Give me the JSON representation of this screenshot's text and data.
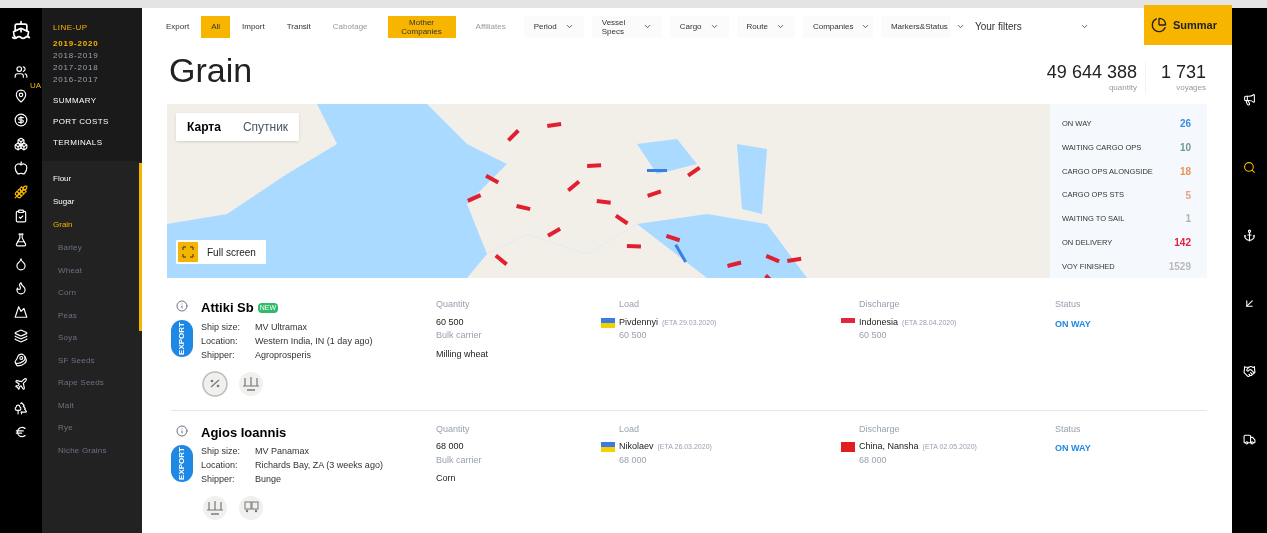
{
  "nav": {
    "section_title": "LINE-UP",
    "seasons": [
      {
        "label": "2019-2020",
        "selected": true
      },
      {
        "label": "2018-2019",
        "selected": false
      },
      {
        "label": "2017-2018",
        "selected": false
      },
      {
        "label": "2016-2017",
        "selected": false
      }
    ],
    "links": [
      "SUMMARY",
      "PORT COSTS",
      "TERMINALS"
    ],
    "badge": "UA",
    "cargo": [
      {
        "label": "Flour",
        "selected": false
      },
      {
        "label": "Sugar",
        "selected": false
      },
      {
        "label": "Grain",
        "selected": true,
        "children": [
          "Barley",
          "Wheat",
          "Corn",
          "Peas",
          "Soya",
          "SF Seeds",
          "Rape Seeds",
          "Malt",
          "Rye",
          "Niche Grains"
        ]
      }
    ]
  },
  "filters": [
    {
      "kind": "toggle",
      "label": "Export",
      "selected": false,
      "disabled": false
    },
    {
      "kind": "toggle",
      "label": "All",
      "selected": true,
      "disabled": false
    },
    {
      "kind": "toggle",
      "label": "Import",
      "selected": false,
      "disabled": false
    },
    {
      "kind": "toggle",
      "label": "Transit",
      "selected": false,
      "disabled": false
    },
    {
      "kind": "toggle",
      "label": "Cabotage",
      "selected": false,
      "disabled": true
    },
    {
      "kind": "toggle",
      "label": "Mother Companies",
      "selected": true,
      "disabled": false
    },
    {
      "kind": "toggle",
      "label": "Affiliates",
      "selected": false,
      "disabled": true
    },
    {
      "kind": "dropdown",
      "label": "Period"
    },
    {
      "kind": "dropdown",
      "label": "Vessel Specs"
    },
    {
      "kind": "dropdown",
      "label": "Cargo"
    },
    {
      "kind": "dropdown",
      "label": "Route"
    },
    {
      "kind": "dropdown",
      "label": "Companies"
    },
    {
      "kind": "dropdown",
      "label": "Markers&Status"
    }
  ],
  "your_filters": {
    "placeholder": "Your filters"
  },
  "summary_button": "Summar",
  "title": "Grain",
  "totals": [
    {
      "value": "49 644 388",
      "label": "quantity"
    },
    {
      "value": "1 731",
      "label": "voyages"
    }
  ],
  "map": {
    "tabs": [
      {
        "label": "Карта",
        "selected": true
      },
      {
        "label": "Спутник",
        "selected": false
      }
    ],
    "fullscreen": "Full screen"
  },
  "statuses": [
    {
      "label": "ON WAY",
      "count": "26",
      "color": "#3b8ee0"
    },
    {
      "label": "WAITING CARGO OPS",
      "count": "10",
      "color": "#6b9a9a"
    },
    {
      "label": "CARGO OPS ALONGSIDE",
      "count": "18",
      "color": "#e8925a"
    },
    {
      "label": "CARGO OPS STS",
      "count": "5",
      "color": "#e8a080"
    },
    {
      "label": "WAITING TO SAIL",
      "count": "1",
      "color": "#b0b0b0"
    },
    {
      "label": "ON DELIVERY",
      "count": "142",
      "color": "#e0203a"
    },
    {
      "label": "VOY FINISHED",
      "count": "1529",
      "color": "#b8b8b8"
    }
  ],
  "voyages": [
    {
      "vessel": "Attiki Sb",
      "new_badge": "NEW",
      "direction": "EXPORT",
      "details": [
        {
          "label": "Ship size:",
          "value": "MV Ultramax"
        },
        {
          "label": "Location:",
          "value": "Western India, IN (1 day ago)"
        },
        {
          "label": "Shipper:",
          "value": "Agroprosperis"
        }
      ],
      "markers": [
        {
          "kind": "fuel"
        },
        {
          "kind": "load"
        }
      ],
      "quantity_label": "Quantity",
      "quantity": "60 500",
      "vessel_type": "Bulk carrier",
      "cargo": "Milling wheat",
      "load_label": "Load",
      "load_flag": {
        "kind": "ua"
      },
      "load_port": "Pivdennyi",
      "load_eta": "(ETA 29.03.2020)",
      "load_qty": "60 500",
      "discharge_label": "Discharge",
      "discharge_flag": {
        "kind": "id"
      },
      "discharge_port": "Indonesia",
      "discharge_eta": "(ETA 28.04.2020)",
      "discharge_qty": "60 500",
      "status_label": "Status",
      "status": "ON WAY"
    },
    {
      "vessel": "Agios Ioannis",
      "direction": "EXPORT",
      "details": [
        {
          "label": "Ship size:",
          "value": "MV Panamax"
        },
        {
          "label": "Location:",
          "value": "Richards Bay, ZA (3 weeks ago)"
        },
        {
          "label": "Shipper:",
          "value": "Bunge"
        }
      ],
      "markers": [
        {
          "kind": "load"
        },
        {
          "kind": "train"
        }
      ],
      "quantity_label": "Quantity",
      "quantity": "68 000",
      "vessel_type": "Bulk carrier",
      "cargo": "Corn",
      "load_label": "Load",
      "load_flag": {
        "kind": "ua"
      },
      "load_port": "Nikolaev",
      "load_eta": "(ETA 26.03.2020)",
      "load_qty": "68 000",
      "discharge_label": "Discharge",
      "discharge_flag": {
        "kind": "cn"
      },
      "discharge_port": "China, Nansha",
      "discharge_eta": "(ETA 02.05.2020)",
      "discharge_qty": "68 000",
      "status_label": "Status",
      "status": "ON WAY"
    }
  ]
}
